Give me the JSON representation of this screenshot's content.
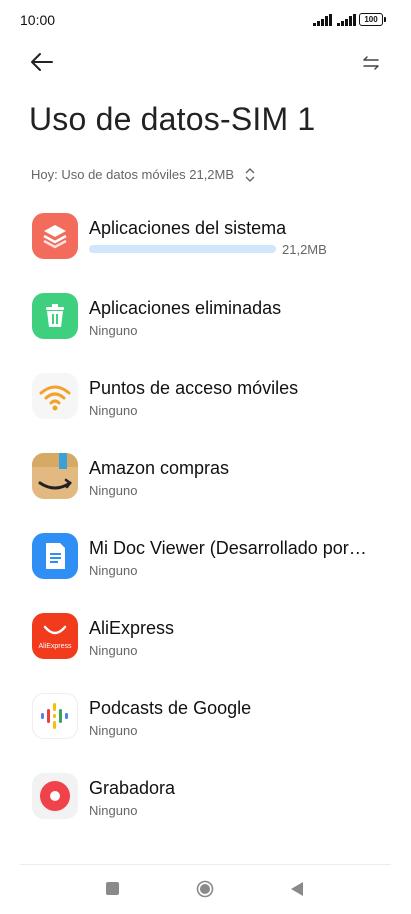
{
  "status": {
    "time": "10:00",
    "battery": "100"
  },
  "header": {
    "title": "Uso de datos-SIM 1"
  },
  "summary": {
    "text": "Hoy: Uso de datos móviles 21,2MB"
  },
  "apps": [
    {
      "name": "Aplicaciones del sistema",
      "usage": "21,2MB",
      "usage_fraction": 1.0,
      "icon": "layers-icon",
      "color": "#f26b5b"
    },
    {
      "name": "Aplicaciones eliminadas",
      "sub": "Ninguno",
      "icon": "trash-icon",
      "color": "#3fd07f"
    },
    {
      "name": "Puntos de acceso móviles",
      "sub": "Ninguno",
      "icon": "wifi-icon",
      "color": "#f4a12a"
    },
    {
      "name": "Amazon compras",
      "sub": "Ninguno",
      "icon": "amazon-icon",
      "color": "#e2b980"
    },
    {
      "name": "Mi Doc Viewer (Desarrollado por…",
      "sub": "Ninguno",
      "icon": "document-icon",
      "color": "#2f8ff5"
    },
    {
      "name": "AliExpress",
      "sub": "Ninguno",
      "icon": "aliexpress-icon",
      "color": "#f23a1c",
      "icon_text": "AliExpress"
    },
    {
      "name": "Podcasts de Google",
      "sub": "Ninguno",
      "icon": "podcasts-icon"
    },
    {
      "name": "Grabadora",
      "sub": "Ninguno",
      "icon": "recorder-icon",
      "color": "#f0424a"
    }
  ]
}
